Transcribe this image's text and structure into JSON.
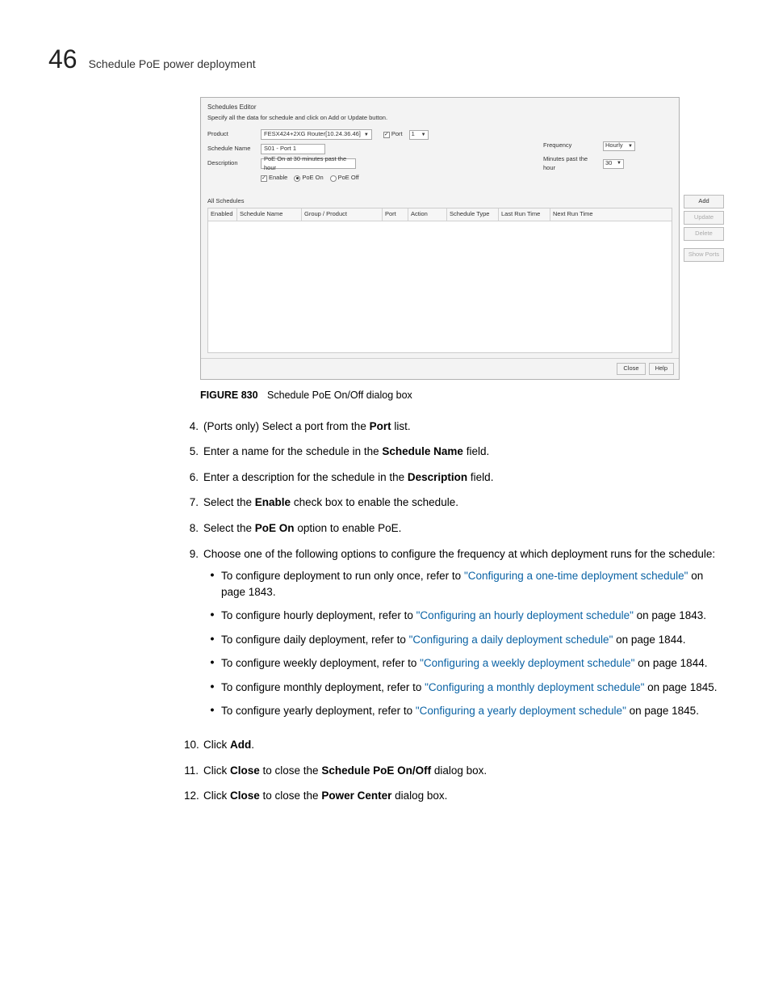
{
  "header": {
    "page_number": "46",
    "section_title": "Schedule PoE power deployment"
  },
  "dialog": {
    "title": "Schedules Editor",
    "instruction": "Specify all the data for schedule and click on Add or Update button.",
    "labels": {
      "product": "Product",
      "schedule_name": "Schedule  Name",
      "description": "Description",
      "port": "Port",
      "enable": "Enable",
      "poe_on": "PoE On",
      "poe_off": "PoE Off",
      "frequency": "Frequency",
      "minutes_past": "Minutes past the hour"
    },
    "values": {
      "product": "FESX424+2XG Router[10.24.36.46]",
      "schedule_name": "S01 - Port 1",
      "description": "PoE On at 30 minutes past the hour",
      "port": "1",
      "frequency": "Hourly",
      "minutes_past": "30"
    },
    "all_schedules_label": "All Schedules",
    "table_headers": {
      "enabled": "Enabled",
      "schedule_name": "Schedule Name",
      "group_product": "Group / Product",
      "port": "Port",
      "action": "Action",
      "schedule_type": "Schedule Type",
      "last_run_time": "Last Run Time",
      "next_run_time": "Next Run Time"
    },
    "side_buttons": {
      "add": "Add",
      "update": "Update",
      "delete": "Delete",
      "show_ports": "Show Ports"
    },
    "footer_buttons": {
      "close": "Close",
      "help": "Help"
    }
  },
  "figure": {
    "label": "FIGURE 830",
    "caption": "Schedule PoE On/Off dialog box"
  },
  "steps": {
    "s4": {
      "num": "4.",
      "pre": "(Ports only) Select a port from the ",
      "bold": "Port",
      "post": " list."
    },
    "s5": {
      "num": "5.",
      "pre": "Enter a name for the schedule in the ",
      "bold": "Schedule Name",
      "post": " field."
    },
    "s6": {
      "num": "6.",
      "pre": "Enter a description for the schedule in the ",
      "bold": "Description",
      "post": " field."
    },
    "s7": {
      "num": "7.",
      "pre": "Select the ",
      "bold": "Enable",
      "post": " check box to enable the schedule."
    },
    "s8": {
      "num": "8.",
      "pre": "Select the ",
      "bold": "PoE On",
      "post": " option to enable PoE."
    },
    "s9": {
      "num": "9.",
      "text": "Choose one of the following options to configure the frequency at which deployment runs for the schedule:"
    },
    "s10": {
      "num": "10.",
      "pre": "Click ",
      "bold": "Add",
      "post": "."
    },
    "s11": {
      "num": "11.",
      "pre1": "Click ",
      "bold1": "Close",
      "mid": " to close the ",
      "bold2": "Schedule PoE On/Off",
      "post": " dialog box."
    },
    "s12": {
      "num": "12.",
      "pre1": "Click ",
      "bold1": "Close",
      "mid": " to close the ",
      "bold2": "Power Center",
      "post": " dialog box."
    }
  },
  "bullets": {
    "b1": {
      "pre": "To configure deployment to run only once, refer to ",
      "link": "\"Configuring a one-time deployment schedule\"",
      "post": " on page 1843."
    },
    "b2": {
      "pre": "To configure hourly deployment, refer to ",
      "link": "\"Configuring an hourly deployment schedule\"",
      "post": " on page 1843."
    },
    "b3": {
      "pre": "To configure daily deployment, refer to ",
      "link": "\"Configuring a daily deployment schedule\"",
      "post": " on page 1844."
    },
    "b4": {
      "pre": "To configure weekly deployment, refer to ",
      "link": "\"Configuring a weekly deployment schedule\"",
      "post": " on page 1844."
    },
    "b5": {
      "pre": "To configure monthly deployment, refer to ",
      "link": "\"Configuring a monthly deployment schedule\"",
      "post": " on page 1845."
    },
    "b6": {
      "pre": "To configure yearly deployment, refer to ",
      "link": "\"Configuring a yearly deployment schedule\"",
      "post": " on page 1845."
    }
  }
}
